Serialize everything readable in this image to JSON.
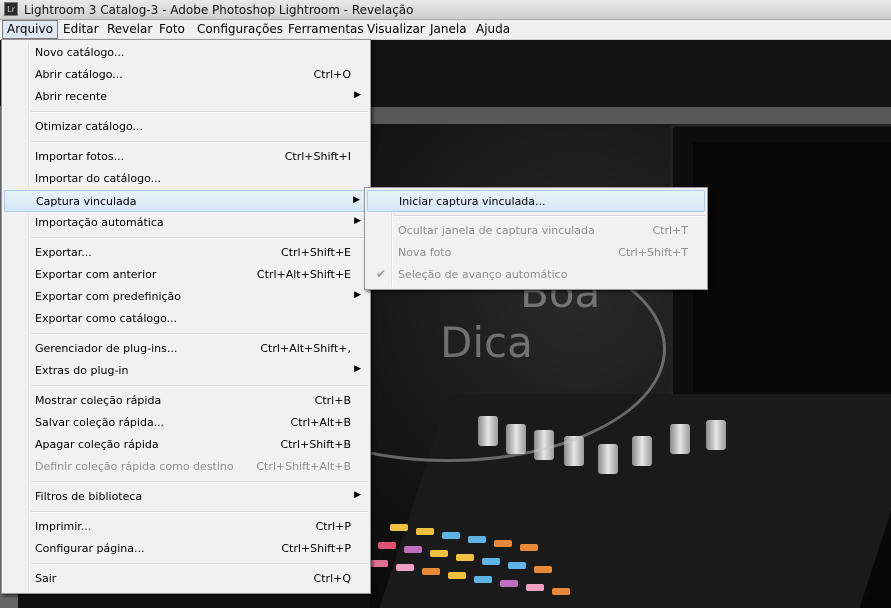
{
  "title_bar": {
    "title": "Lightroom 3 Catalog-3 - Adobe Photoshop Lightroom - Revelação",
    "icon_text": "Lr"
  },
  "menubar": [
    "Arquivo",
    "Editar",
    "Revelar",
    "Foto",
    "Configurações",
    "Ferramentas",
    "Visualizar",
    "Janela",
    "Ajuda"
  ],
  "file_menu": [
    {
      "label": "Novo catálogo...",
      "shortcut": ""
    },
    {
      "label": "Abrir catálogo...",
      "shortcut": "Ctrl+O"
    },
    {
      "label": "Abrir recente",
      "shortcut": "",
      "submenu": true
    },
    {
      "label": "Otimizar catálogo...",
      "shortcut": ""
    },
    {
      "label": "Importar fotos...",
      "shortcut": "Ctrl+Shift+I"
    },
    {
      "label": "Importar do catálogo...",
      "shortcut": ""
    },
    {
      "label": "Captura vinculada",
      "shortcut": "",
      "submenu": true,
      "highlighted": true
    },
    {
      "label": "Importação automática",
      "shortcut": "",
      "submenu": true
    },
    {
      "label": "Exportar...",
      "shortcut": "Ctrl+Shift+E"
    },
    {
      "label": "Exportar com anterior",
      "shortcut": "Ctrl+Alt+Shift+E"
    },
    {
      "label": "Exportar com predefinição",
      "shortcut": "",
      "submenu": true
    },
    {
      "label": "Exportar como catálogo...",
      "shortcut": ""
    },
    {
      "label": "Gerenciador de plug-ins...",
      "shortcut": "Ctrl+Alt+Shift+,"
    },
    {
      "label": "Extras do plug-in",
      "shortcut": "",
      "submenu": true
    },
    {
      "label": "Mostrar coleção rápida",
      "shortcut": "Ctrl+B"
    },
    {
      "label": "Salvar coleção rápida...",
      "shortcut": "Ctrl+Alt+B"
    },
    {
      "label": "Apagar coleção rápida",
      "shortcut": "Ctrl+Shift+B"
    },
    {
      "label": "Definir coleção rápida como destino",
      "shortcut": "Ctrl+Shift+Alt+B",
      "disabled": true
    },
    {
      "label": "Filtros de biblioteca",
      "shortcut": "",
      "submenu": true
    },
    {
      "label": "Imprimir...",
      "shortcut": "Ctrl+P"
    },
    {
      "label": "Configurar página...",
      "shortcut": "Ctrl+Shift+P"
    },
    {
      "label": "Sair",
      "shortcut": "Ctrl+Q"
    }
  ],
  "submenu": [
    {
      "label": "Iniciar captura vinculada...",
      "shortcut": "",
      "highlighted": true
    },
    {
      "label": "Ocultar janela de captura vinculada",
      "shortcut": "Ctrl+T",
      "disabled": true
    },
    {
      "label": "Nova foto",
      "shortcut": "Ctrl+Shift+T",
      "disabled": true
    },
    {
      "label": "Seleção de avanço automático",
      "shortcut": "",
      "disabled": true,
      "checked": true
    }
  ],
  "watermark": {
    "line1": "Boa",
    "line2": "Dica"
  },
  "colors": {
    "highlight": "#d4e6f6",
    "menu_bg": "#f1f1f1",
    "disabled_text": "#8d8d8d"
  }
}
